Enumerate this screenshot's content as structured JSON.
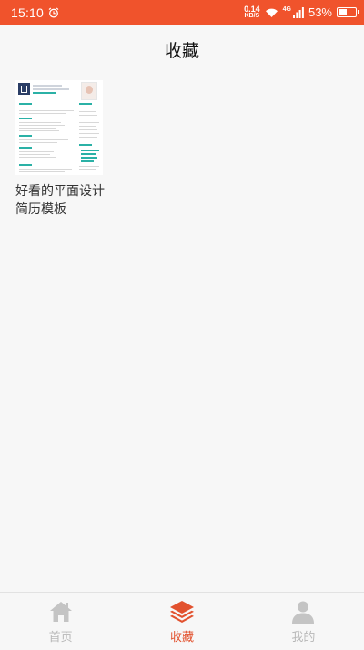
{
  "status_bar": {
    "time": "15:10",
    "net_speed_value": "0.14",
    "net_speed_unit": "KB/S",
    "network_type": "4G",
    "battery_percent": "53%",
    "battery_level": 0.53,
    "background_color": "#f0532c"
  },
  "header": {
    "title": "收藏"
  },
  "favorites": [
    {
      "title": "好看的平面设计简历模板",
      "thumbnail_icon": "resume-thumbnail"
    }
  ],
  "bottom_nav": {
    "active_color": "#e2522f",
    "inactive_color": "#b8b8b8",
    "items": [
      {
        "label": "首页",
        "icon": "home-icon",
        "active": false
      },
      {
        "label": "收藏",
        "icon": "layers-icon",
        "active": true
      },
      {
        "label": "我的",
        "icon": "user-icon",
        "active": false
      }
    ]
  }
}
